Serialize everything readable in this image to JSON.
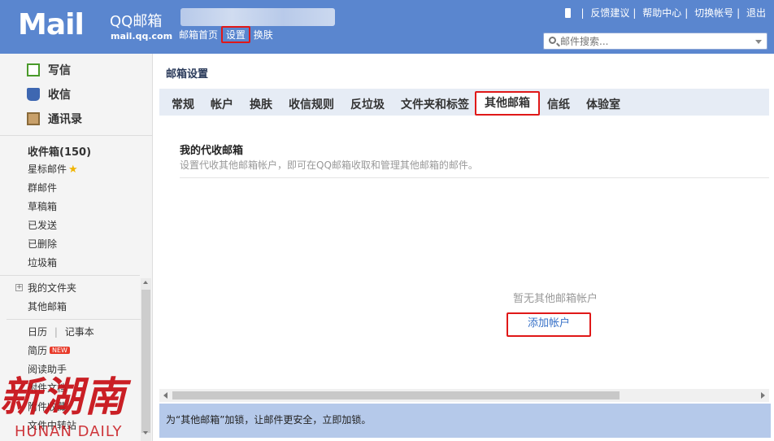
{
  "header": {
    "logo_text": "Mail",
    "logo_qq": "QQ邮箱",
    "logo_domain": "mail.qq.com",
    "nav": [
      {
        "label": "邮箱首页"
      },
      {
        "label": "设置"
      },
      {
        "label": "换肤"
      }
    ],
    "nav_sep": "|",
    "links": [
      {
        "label": "反馈建议"
      },
      {
        "label": "帮助中心"
      },
      {
        "label": "切换帐号"
      },
      {
        "label": "退出"
      }
    ],
    "search_placeholder": "邮件搜索..."
  },
  "sidebar": {
    "quick": [
      {
        "label": "写信",
        "icon": "compose-icon"
      },
      {
        "label": "收信",
        "icon": "inbox-icon"
      },
      {
        "label": "通讯录",
        "icon": "contacts-icon"
      }
    ],
    "folders": [
      {
        "label": "收件箱(150)"
      },
      {
        "label": "星标邮件"
      },
      {
        "label": "群邮件"
      },
      {
        "label": "草稿箱"
      },
      {
        "label": "已发送"
      },
      {
        "label": "已删除"
      },
      {
        "label": "垃圾箱"
      }
    ],
    "my_folders": "我的文件夹",
    "other_mailbox": "其他邮箱",
    "calendar": "日历",
    "notebook": "记事本",
    "resume": "简历",
    "new_badge": "NEW",
    "reading": "阅读助手",
    "docs": "附件文档",
    "favorites": "附件收藏",
    "transfer": "文件中转站"
  },
  "watermark": {
    "cn": "新湖南",
    "en": "HUNAN DAILY"
  },
  "main": {
    "title": "邮箱设置",
    "tabs": [
      {
        "label": "常规"
      },
      {
        "label": "帐户"
      },
      {
        "label": "换肤"
      },
      {
        "label": "收信规则"
      },
      {
        "label": "反垃圾"
      },
      {
        "label": "文件夹和标签"
      },
      {
        "label": "其他邮箱"
      },
      {
        "label": "信纸"
      },
      {
        "label": "体验室"
      }
    ],
    "active_tab": "其他邮箱",
    "section_title": "我的代收邮箱",
    "section_desc": "设置代收其他邮箱帐户，即可在QQ邮箱收取和管理其他邮箱的邮件。",
    "empty_text": "暂无其他邮箱帐户",
    "add_account": "添加帐户",
    "notice": "为“其他邮箱”加锁，让邮件更安全，立即加锁。"
  },
  "colors": {
    "header_bg": "#5a86cf",
    "highlight": "#e01818",
    "link": "#3670c7",
    "notice_bg": "#b5c9ea"
  }
}
